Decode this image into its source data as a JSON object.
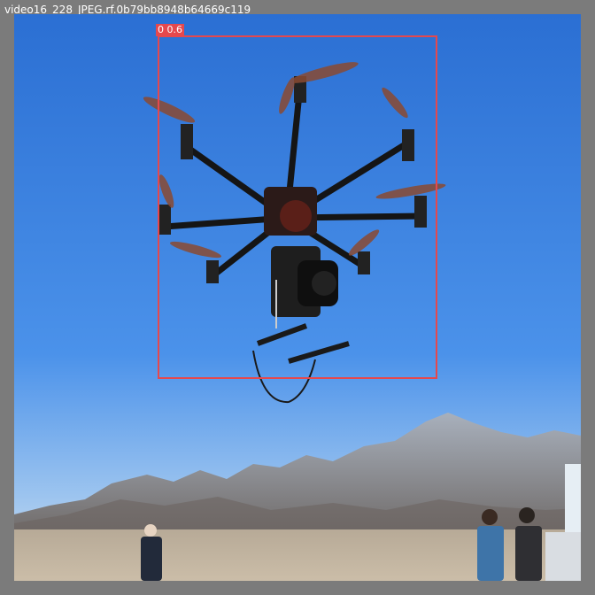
{
  "image": {
    "caption": "video16_228_JPEG.rf.0b79bb8948b64669c119"
  },
  "detection": {
    "label": "0 0.6",
    "box_color": "#e5484d"
  },
  "scene": {
    "sky_color": "#3f88e6",
    "ground_color": "#c9bca8",
    "mountain_color": "#8a8f9a"
  }
}
